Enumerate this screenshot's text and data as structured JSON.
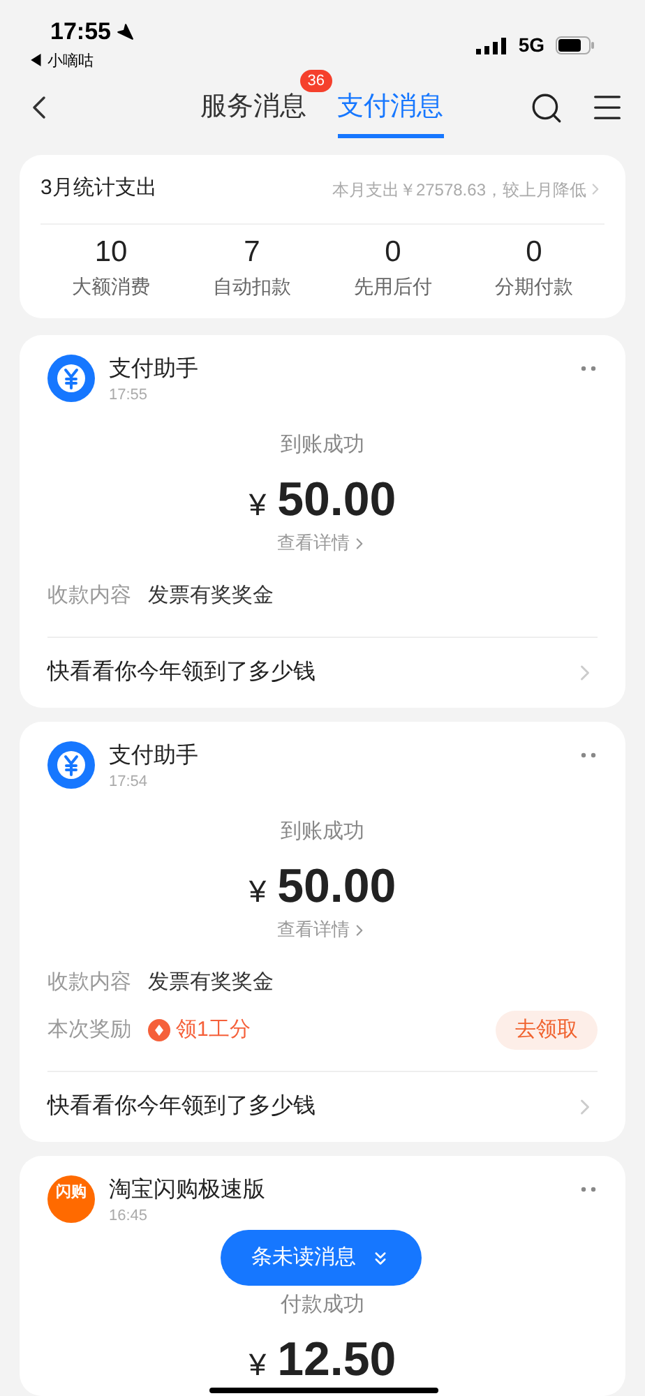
{
  "status_bar": {
    "time": "17:55",
    "back_app": "◀ 小嘀咕",
    "network": "5G"
  },
  "header": {
    "tabs": [
      {
        "label": "服务消息",
        "selected": false,
        "badge": "36"
      },
      {
        "label": "支付消息",
        "selected": true
      }
    ]
  },
  "summary": {
    "title": "3月统计支出",
    "note": "本月支出￥27578.63，较上月降低",
    "stats": [
      {
        "value": "10",
        "label": "大额消费"
      },
      {
        "value": "7",
        "label": "自动扣款"
      },
      {
        "value": "0",
        "label": "先用后付"
      },
      {
        "value": "0",
        "label": "分期付款"
      }
    ]
  },
  "cards": [
    {
      "kind": "assistant",
      "sender": "支付助手",
      "time": "17:55",
      "status": "到账成功",
      "currency": "¥",
      "amount": "50.00",
      "detail_link": "查看详情",
      "rows": [
        {
          "kind": "text",
          "label": "收款内容",
          "value": "发票有奖奖金"
        }
      ],
      "footer": "快看看你今年领到了多少钱"
    },
    {
      "kind": "assistant",
      "sender": "支付助手",
      "time": "17:54",
      "status": "到账成功",
      "currency": "¥",
      "amount": "50.00",
      "detail_link": "查看详情",
      "rows": [
        {
          "kind": "text",
          "label": "收款内容",
          "value": "发票有奖奖金"
        },
        {
          "kind": "reward",
          "label": "本次奖励",
          "value": "领1工分",
          "action": "去领取"
        }
      ],
      "footer": "快看看你今年领到了多少钱"
    },
    {
      "kind": "shop",
      "logo_text": "闪购",
      "sender": "淘宝闪购极速版",
      "time": "16:45",
      "status": "付款成功",
      "currency": "¥",
      "amount": "12.50"
    }
  ],
  "unread_pill": {
    "label": "条未读消息"
  }
}
